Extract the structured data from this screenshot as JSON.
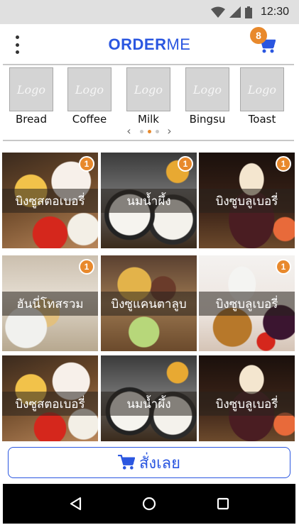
{
  "status_bar": {
    "time": "12:30"
  },
  "header": {
    "brand_bold": "ORDER",
    "brand_light": "ME",
    "cart_count": "8"
  },
  "categories": [
    {
      "logo_text": "Logo",
      "label": "Bread"
    },
    {
      "logo_text": "Logo",
      "label": "Coffee"
    },
    {
      "logo_text": "Logo",
      "label": "Milk"
    },
    {
      "logo_text": "Logo",
      "label": "Bingsu"
    },
    {
      "logo_text": "Logo",
      "label": "Toast"
    }
  ],
  "pager": {
    "prev": "‹",
    "next": "›",
    "pages": 3,
    "active_page": 2
  },
  "menu_items": [
    {
      "name": "บิงซูสตอเบอรี่",
      "count": "1",
      "image": "strawberry"
    },
    {
      "name": "นมน้ำผึ้ง",
      "count": "1",
      "image": "milk"
    },
    {
      "name": "บิงซูบลูเบอรี่",
      "count": "1",
      "image": "blueberry"
    },
    {
      "name": "ฮันนี่โทสรวม",
      "count": "1",
      "image": "honey"
    },
    {
      "name": "บิงซูแคนตาลูบ",
      "count": "",
      "image": "cantaloupe"
    },
    {
      "name": "บิงซูบลูเบอรี่",
      "count": "1",
      "image": "blueberry2"
    },
    {
      "name": "บิงซูสตอเบอรี่",
      "count": "",
      "image": "strawberry"
    },
    {
      "name": "นมน้ำผึ้ง",
      "count": "",
      "image": "milk"
    },
    {
      "name": "บิงซูบลูเบอรี่",
      "count": "",
      "image": "blueberry"
    }
  ],
  "order_button": {
    "label": "สั่งเลย"
  },
  "colors": {
    "brand_blue": "#2a56e0",
    "badge_orange": "#e8892c",
    "status_bar": "#e0e0e0",
    "nav_bar": "#000000"
  }
}
